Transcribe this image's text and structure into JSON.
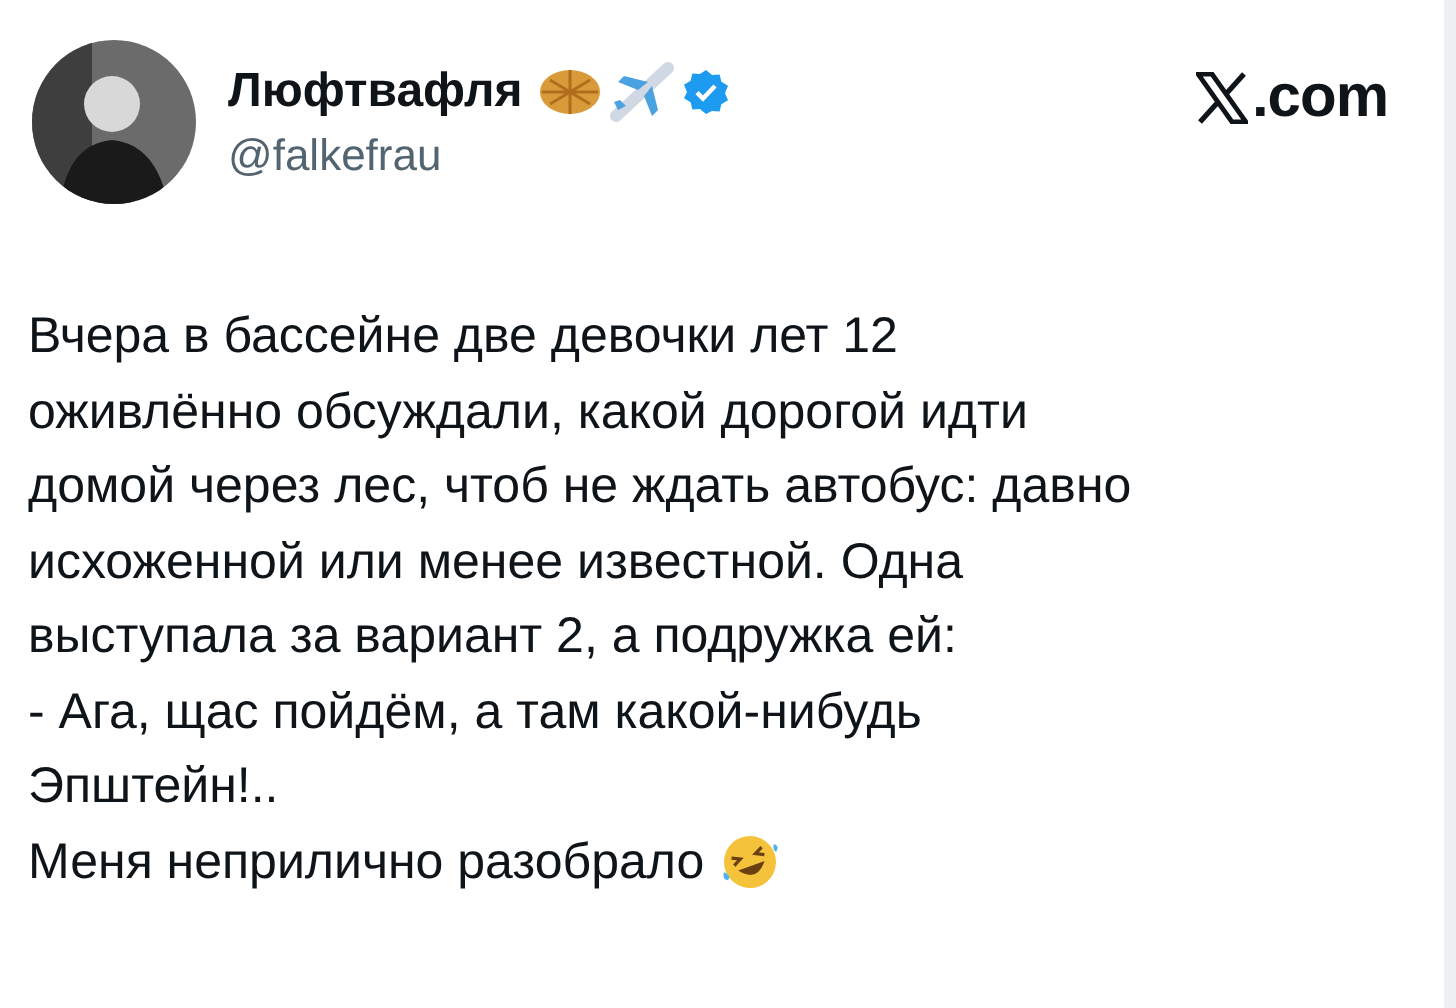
{
  "author": {
    "name": "Люфтвафля",
    "handle": "@falkefrau",
    "verified": true
  },
  "site": {
    "domain": ".com"
  },
  "tweet": {
    "lines": [
      "Вчера в бассейне две девочки лет 12",
      "оживлённо обсуждали, какой дорогой идти",
      "домой через лес, чтоб не ждать автобус: давно",
      "исхоженной или менее известной. Одна",
      "выступала за вариант 2, а подружка ей:",
      "- Ага, щас пойдём, а там какой-нибудь",
      "Эпштейн!..",
      "Меня неприлично разобрало"
    ]
  }
}
